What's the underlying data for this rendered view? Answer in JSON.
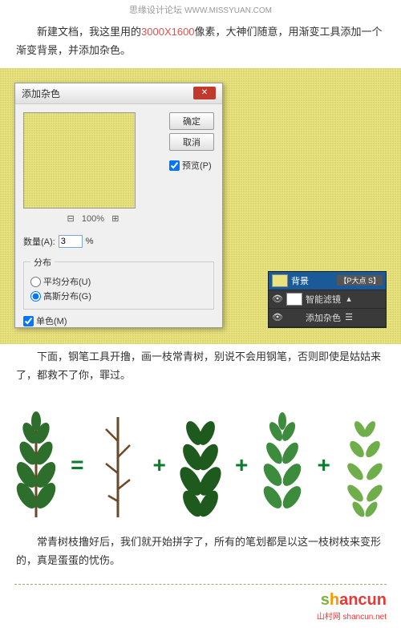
{
  "header": {
    "site": "思缘设计论坛",
    "url": "WWW.MISSYUAN.COM"
  },
  "para1": {
    "prefix": "新建文档，我这里用的",
    "size": "3000X1600",
    "suffix": "像素，大神们随意，用渐变工具添加一个渐变背景，并添加杂色。"
  },
  "dialog": {
    "title": "添加杂色",
    "ok": "确定",
    "cancel": "取消",
    "preview_chk": "预览(P)",
    "zoom": "100%",
    "amount_label": "数量(A):",
    "amount_value": "3",
    "amount_unit": "%",
    "dist_legend": "分布",
    "dist_uniform": "平均分布(U)",
    "dist_gaussian": "高斯分布(G)",
    "mono": "单色(M)"
  },
  "layers": {
    "bg": "背景",
    "bg_badge": "【P大点 S】",
    "smart": "智能滤镜",
    "noise": "添加杂色"
  },
  "para2": "下面，钢笔工具开撸，画一枝常青树，别说不会用钢笔，否则即使是姑姑来了，都救不了你，罪过。",
  "ops": {
    "eq": "=",
    "plus": "+"
  },
  "para3": "常青树枝撸好后，我们就开始拼字了，所有的笔划都是以这一枝树枝来变形的，真是蛋蛋的忧伤。",
  "logo": {
    "s": "s",
    "h": "h",
    "rest": "ancun",
    "sub": "山村网 shancun.net"
  }
}
